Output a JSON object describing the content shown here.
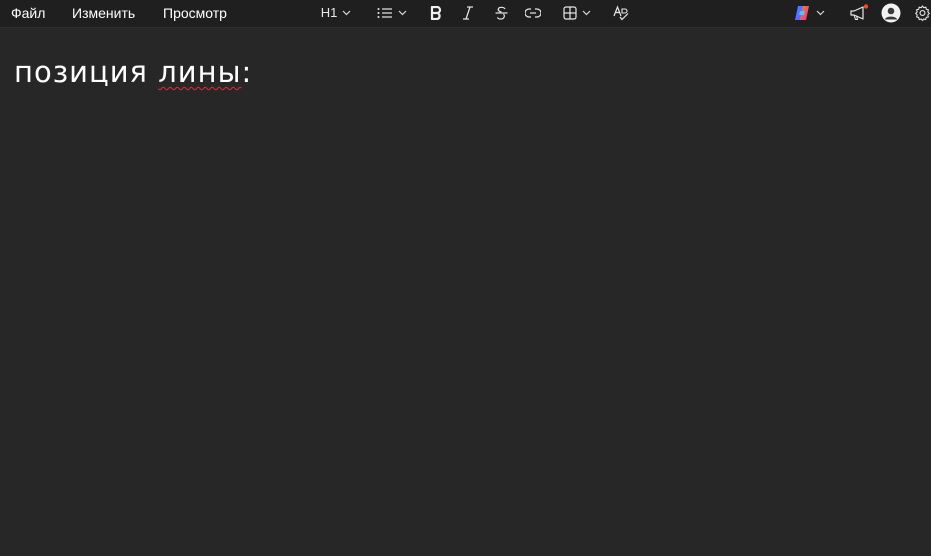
{
  "menu": {
    "file": "Файл",
    "edit": "Изменить",
    "view": "Просмотр"
  },
  "toolbar": {
    "heading_style": "H1",
    "icons": [
      "list-icon",
      "bold-icon",
      "italic-icon",
      "strikethrough-icon",
      "link-icon",
      "table-icon",
      "spellcheck-icon",
      "copilot-icon",
      "megaphone-icon",
      "account-icon",
      "settings-icon"
    ],
    "notification_dot_color": "#e74c3c"
  },
  "document": {
    "heading_word_1": "позиция",
    "heading_word_2": "лины",
    "heading_punct": ":"
  },
  "colors": {
    "background": "#272727",
    "toolbar": "#1f1f1f",
    "text": "#ffffff",
    "spellcheck_underline": "#e03030"
  }
}
